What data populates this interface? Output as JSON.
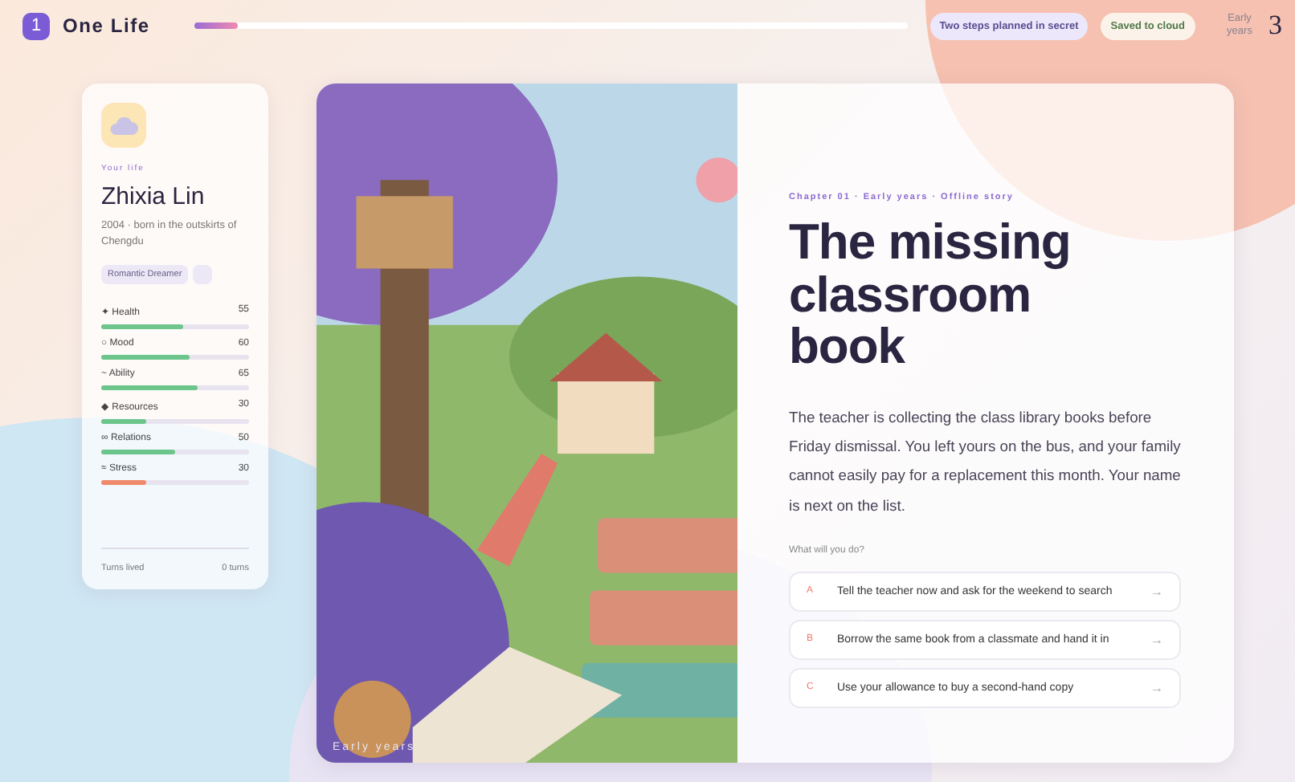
{
  "header": {
    "badge": "1",
    "title": "One Life",
    "progress": {
      "level": 0.06
    },
    "pills": [
      {
        "label": "Two steps planned in secret",
        "kind": "plan"
      },
      {
        "label": "Saved to cloud",
        "kind": "save"
      }
    ],
    "stage": {
      "label": "Early years",
      "number": "3"
    }
  },
  "profile": {
    "eyebrow": "Your life",
    "name": "Zhixia Lin",
    "bio": "2004 · born in the outskirts of Chengdu",
    "tags": [
      "Romantic Dreamer"
    ],
    "stats": [
      {
        "icon": "✦",
        "name": "Health",
        "value": "55",
        "level": 0.55,
        "color": "#6cc58b"
      },
      {
        "icon": "○",
        "name": "Mood",
        "value": "60",
        "level": 0.6,
        "color": "#6cc58b"
      },
      {
        "icon": "~",
        "name": "Ability",
        "value": "65",
        "level": 0.65,
        "color": "#6cc58b"
      },
      {
        "icon": "◆",
        "name": "Resources",
        "value": "30",
        "level": 0.3,
        "color": "#6cc58b"
      },
      {
        "icon": "∞",
        "name": "Relations",
        "value": "50",
        "level": 0.5,
        "color": "#6cc58b"
      },
      {
        "icon": "≈",
        "name": "Stress",
        "value": "30",
        "level": 0.3,
        "color": "#f08a6a"
      }
    ],
    "footer": {
      "label": "Turns lived",
      "value": "0 turns"
    }
  },
  "story": {
    "image": {
      "kind": "picture",
      "caption": "Early years"
    },
    "eyebrow": "Chapter 01 · Early years · Offline story",
    "title": "The missing classroom book",
    "body": "The teacher is collecting the class library books before Friday dismissal. You left yours on the bus, and your family cannot easily pay for a replacement this month. Your name is next on the list.",
    "prompt": "What will you do?",
    "choices": [
      {
        "letter": "A",
        "text": "Tell the teacher now and ask for the weekend to search",
        "arrow": "→"
      },
      {
        "letter": "B",
        "text": "Borrow the same book from a classmate and hand it in",
        "arrow": "→"
      },
      {
        "letter": "C",
        "text": "Use your allowance to buy a second-hand copy",
        "arrow": "→"
      }
    ]
  }
}
